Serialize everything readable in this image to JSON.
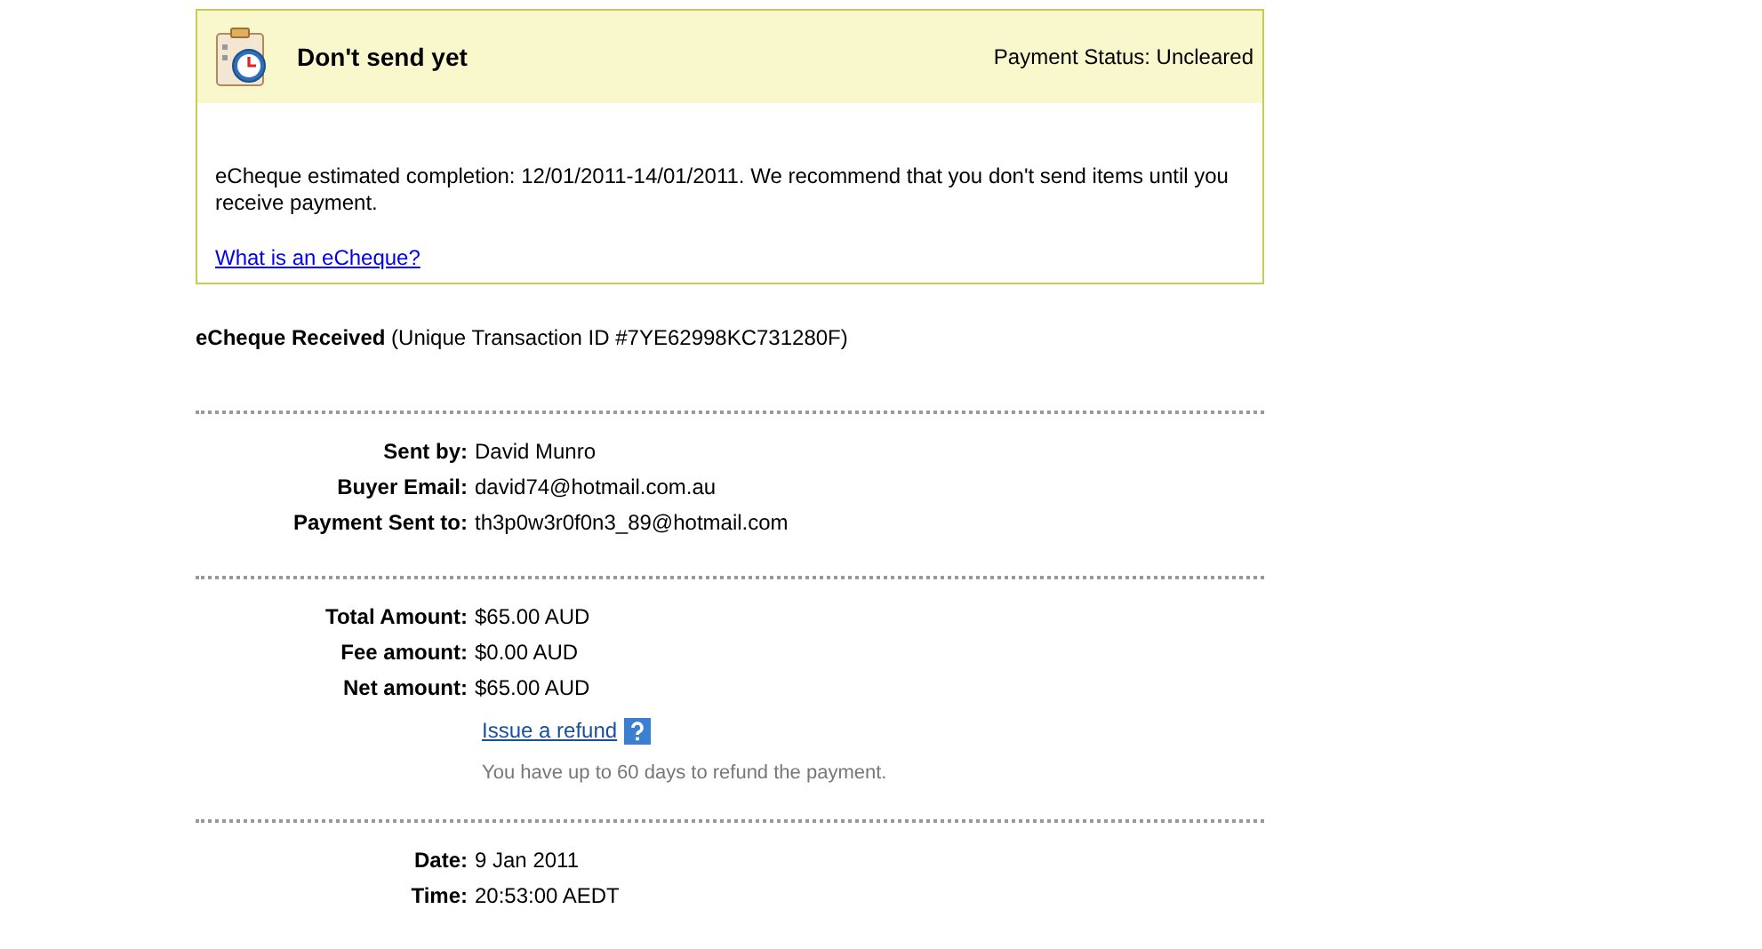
{
  "notice": {
    "title": "Don't send yet",
    "status": "Payment Status: Uncleared",
    "message": "eCheque estimated completion: 12/01/2011-14/01/2011. We recommend that you don't send items until you receive payment.",
    "link": "What is an eCheque?"
  },
  "heading": "**eCheque Received** (Unique Transaction ID #7YE62998KC731280F)",
  "sections": [
    {
      "rows": [
        {
          "label": "Sent by:",
          "value": "David Munro"
        },
        {
          "label": "Buyer Email:",
          "value": "david74@hotmail.com.au"
        },
        {
          "label": "Payment Sent to:",
          "value": "th3p0w3r0f0n3_89@hotmail.com"
        }
      ]
    },
    {
      "rows": [
        {
          "label": "Total Amount:",
          "value": "$65.00 AUD"
        },
        {
          "label": "Fee amount:",
          "value": "$0.00 AUD"
        },
        {
          "label": "Net amount:",
          "value": "$65.00 AUD"
        }
      ],
      "refund": {
        "link": "Issue a refund",
        "note": "You have up to 60 days to refund the payment."
      }
    },
    {
      "rows": [
        {
          "label": "Date:",
          "value": "9 Jan 2011"
        },
        {
          "label": "Time:",
          "value": "20:53:00 AEDT"
        }
      ]
    }
  ]
}
